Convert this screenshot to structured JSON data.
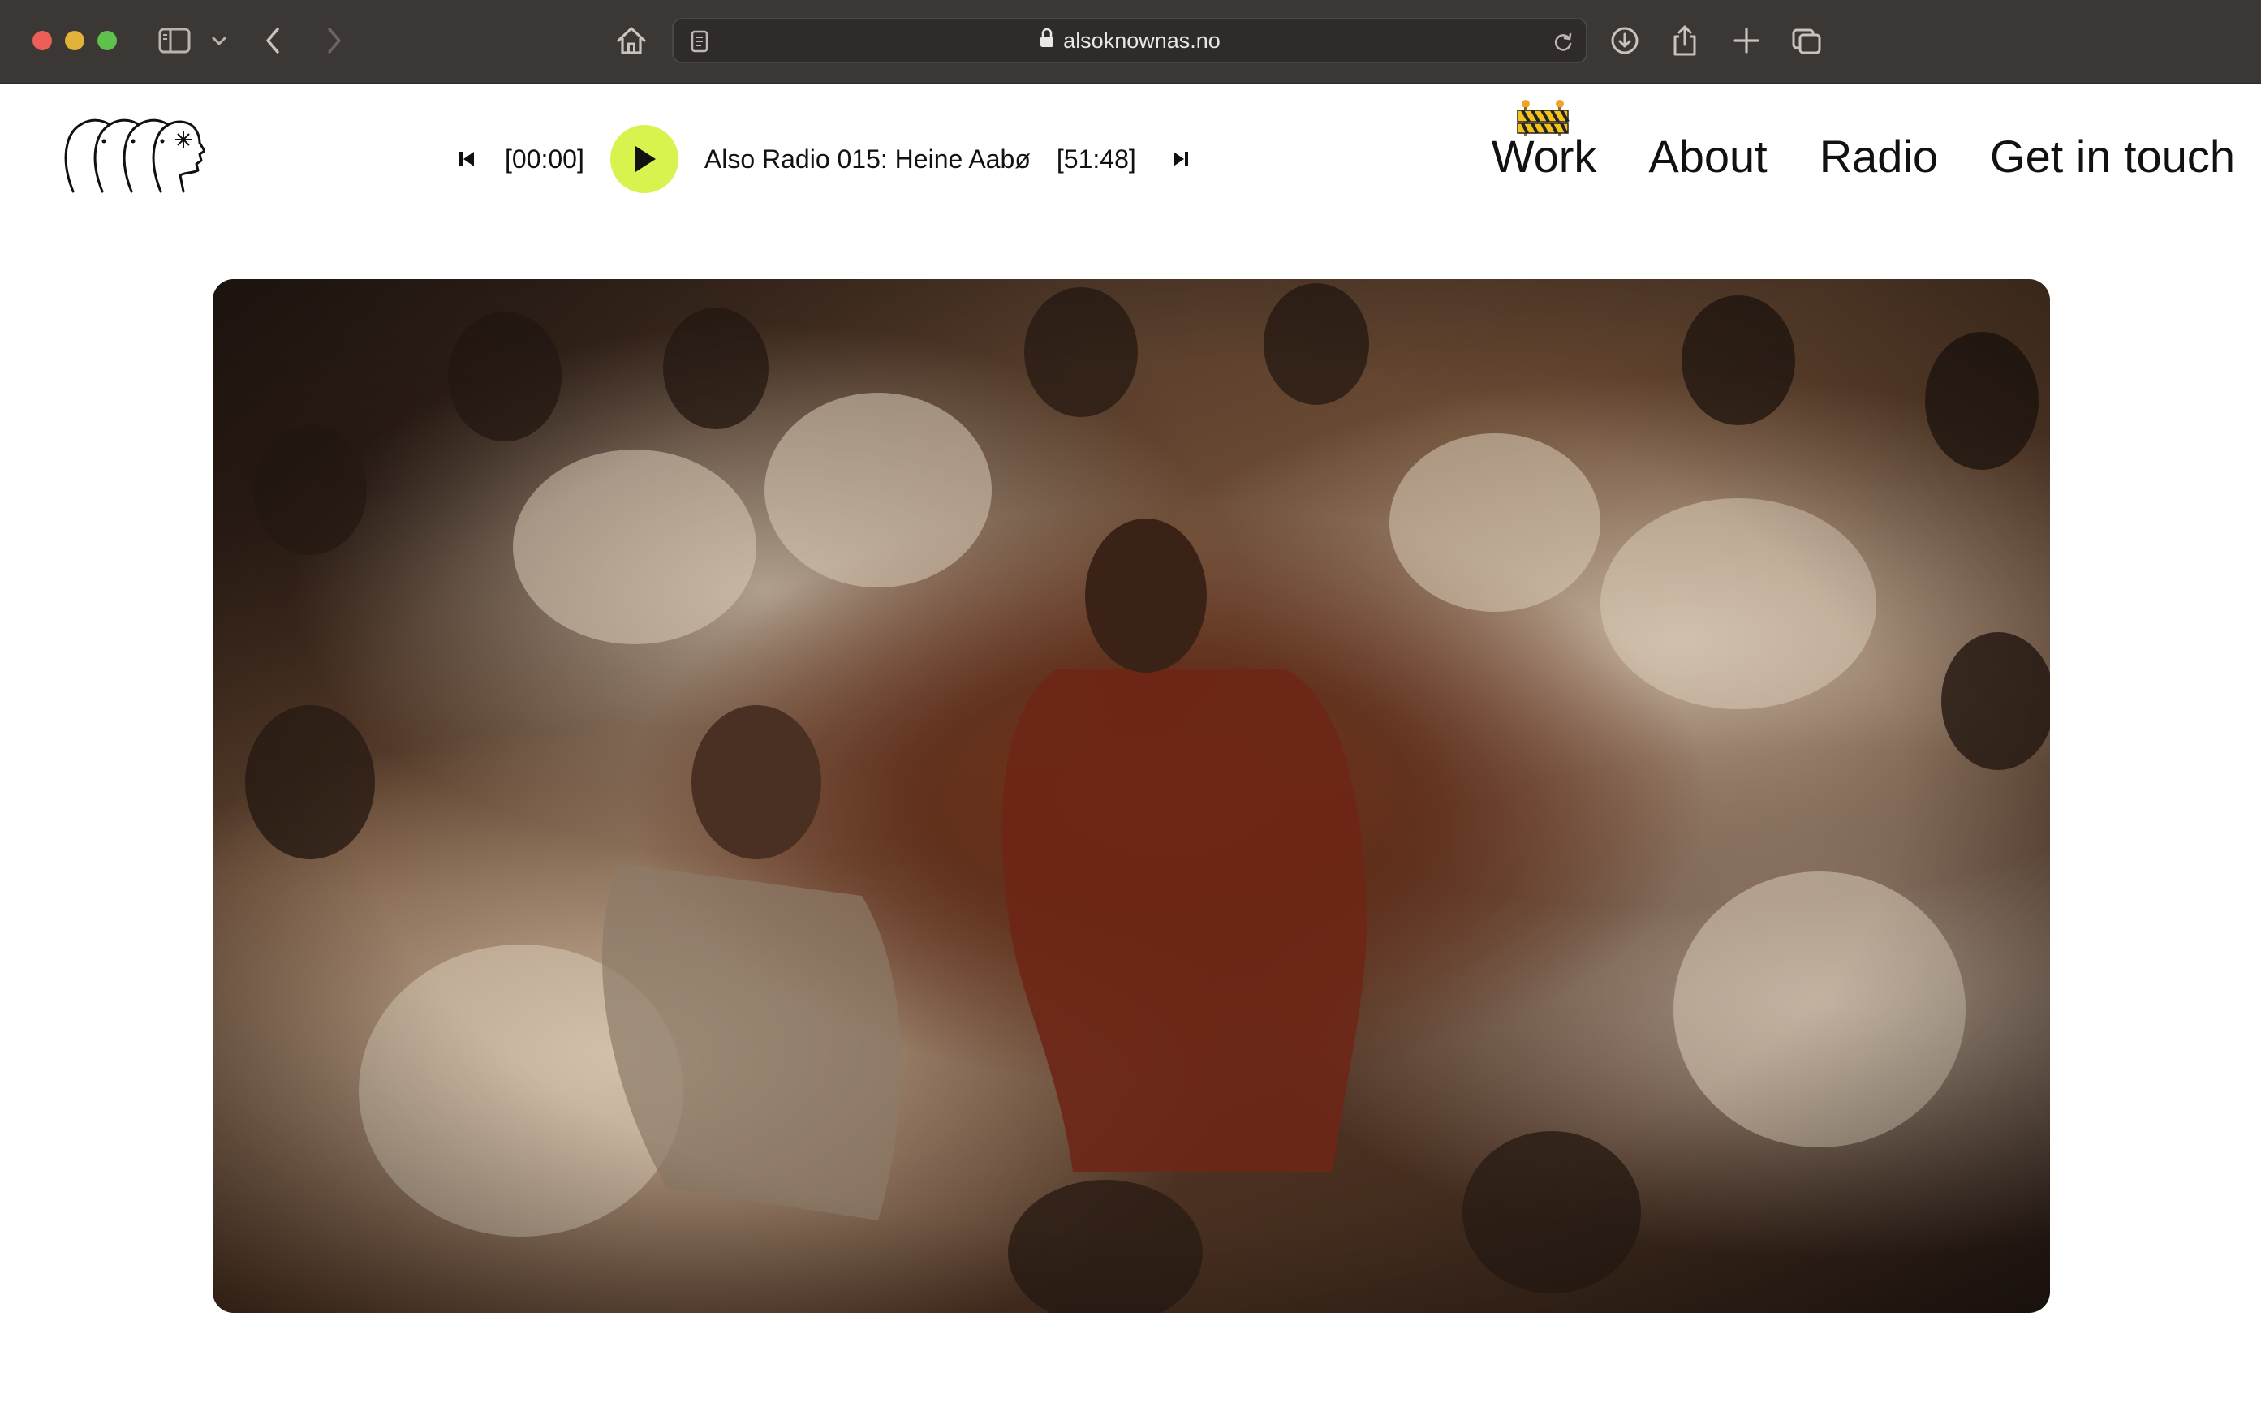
{
  "browser": {
    "url": "alsoknownas.no"
  },
  "player": {
    "current_time": "[00:00]",
    "track_title": "Also Radio 015: Heine Aabø",
    "total_time": "[51:48]",
    "accent_color": "#d8f24e"
  },
  "nav": {
    "items": [
      {
        "label": "Work"
      },
      {
        "label": "About"
      },
      {
        "label": "Radio"
      },
      {
        "label": "Get in touch"
      }
    ]
  },
  "icons": {
    "logo": "four-heads-logo",
    "work_decoration": "construction-barrier-icon"
  }
}
